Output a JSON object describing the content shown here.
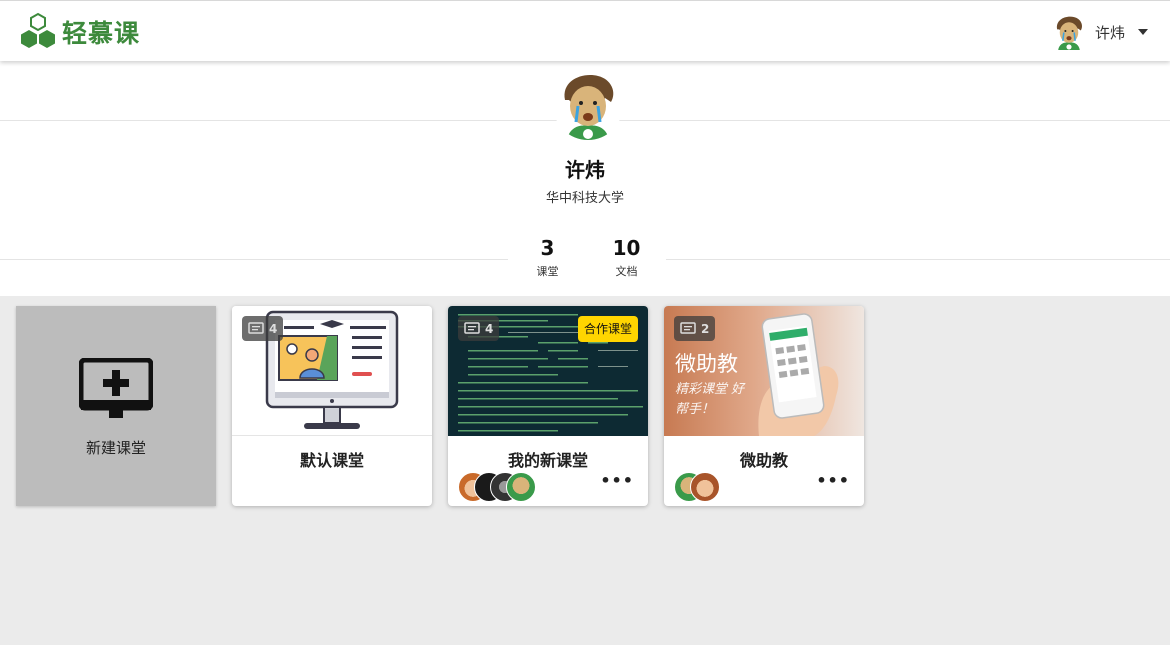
{
  "header": {
    "logo_text": "轻慕课",
    "user_name": "许炜"
  },
  "profile": {
    "name": "许炜",
    "school": "华中科技大学",
    "stats": [
      {
        "value": "3",
        "label": "课堂"
      },
      {
        "value": "10",
        "label": "文档"
      }
    ]
  },
  "new_class": {
    "label": "新建课堂"
  },
  "classes": [
    {
      "title": "默认课堂",
      "count": "4"
    },
    {
      "title": "我的新课堂",
      "count": "4",
      "tag": "合作课堂"
    },
    {
      "title": "微助教",
      "count": "2",
      "cover_text": "微助教",
      "cover_subtext": "精彩课堂 好帮手！"
    }
  ],
  "colors": {
    "brand_green": "#3d8a3c",
    "tag_yellow": "#ffd500",
    "page_bg": "#ebebeb"
  }
}
